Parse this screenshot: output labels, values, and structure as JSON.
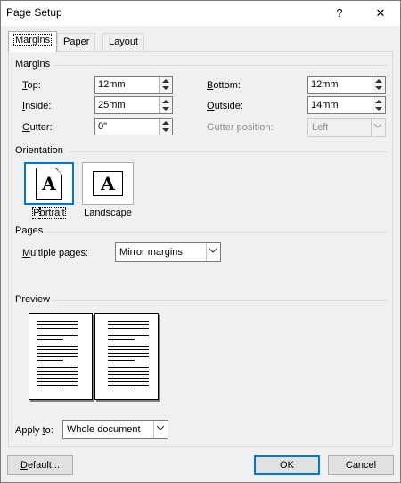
{
  "window": {
    "title": "Page Setup",
    "help": "?",
    "close": "✕"
  },
  "tabs": [
    {
      "label": "Margins",
      "active": true
    },
    {
      "label": "Paper",
      "active": false
    },
    {
      "label": "Layout",
      "active": false
    }
  ],
  "margins": {
    "group_label": "Margins",
    "top": {
      "label_ul": "T",
      "label_rest": "op:",
      "value": "12mm"
    },
    "bottom": {
      "label_ul": "B",
      "label_rest": "ottom:",
      "value": "12mm"
    },
    "inside": {
      "label_ul": "I",
      "label_rest": "nside:",
      "value": "25mm"
    },
    "outside": {
      "label_ul": "O",
      "label_rest": "utside:",
      "value": "14mm"
    },
    "gutter": {
      "label_ul": "G",
      "label_rest": "utter:",
      "value": "0\""
    },
    "gutter_position": {
      "label": "Gutter position:",
      "value": "Left"
    }
  },
  "orientation": {
    "group_label": "Orientation",
    "portrait": {
      "label_ul": "P",
      "label_rest": "ortrait",
      "letter": "A"
    },
    "landscape": {
      "label_pre": "Land",
      "label_ul": "s",
      "label_rest": "cape",
      "letter": "A"
    }
  },
  "pages": {
    "group_label": "Pages",
    "multiple_pages": {
      "label_ul": "M",
      "label_rest": "ultiple pages:",
      "value": "Mirror margins"
    }
  },
  "preview": {
    "group_label": "Preview"
  },
  "apply_to": {
    "label_pre": "Apply ",
    "label_ul": "t",
    "label_rest": "o:",
    "value": "Whole document"
  },
  "buttons": {
    "default_ul": "D",
    "default_rest": "efault...",
    "ok": "OK",
    "cancel": "Cancel"
  }
}
